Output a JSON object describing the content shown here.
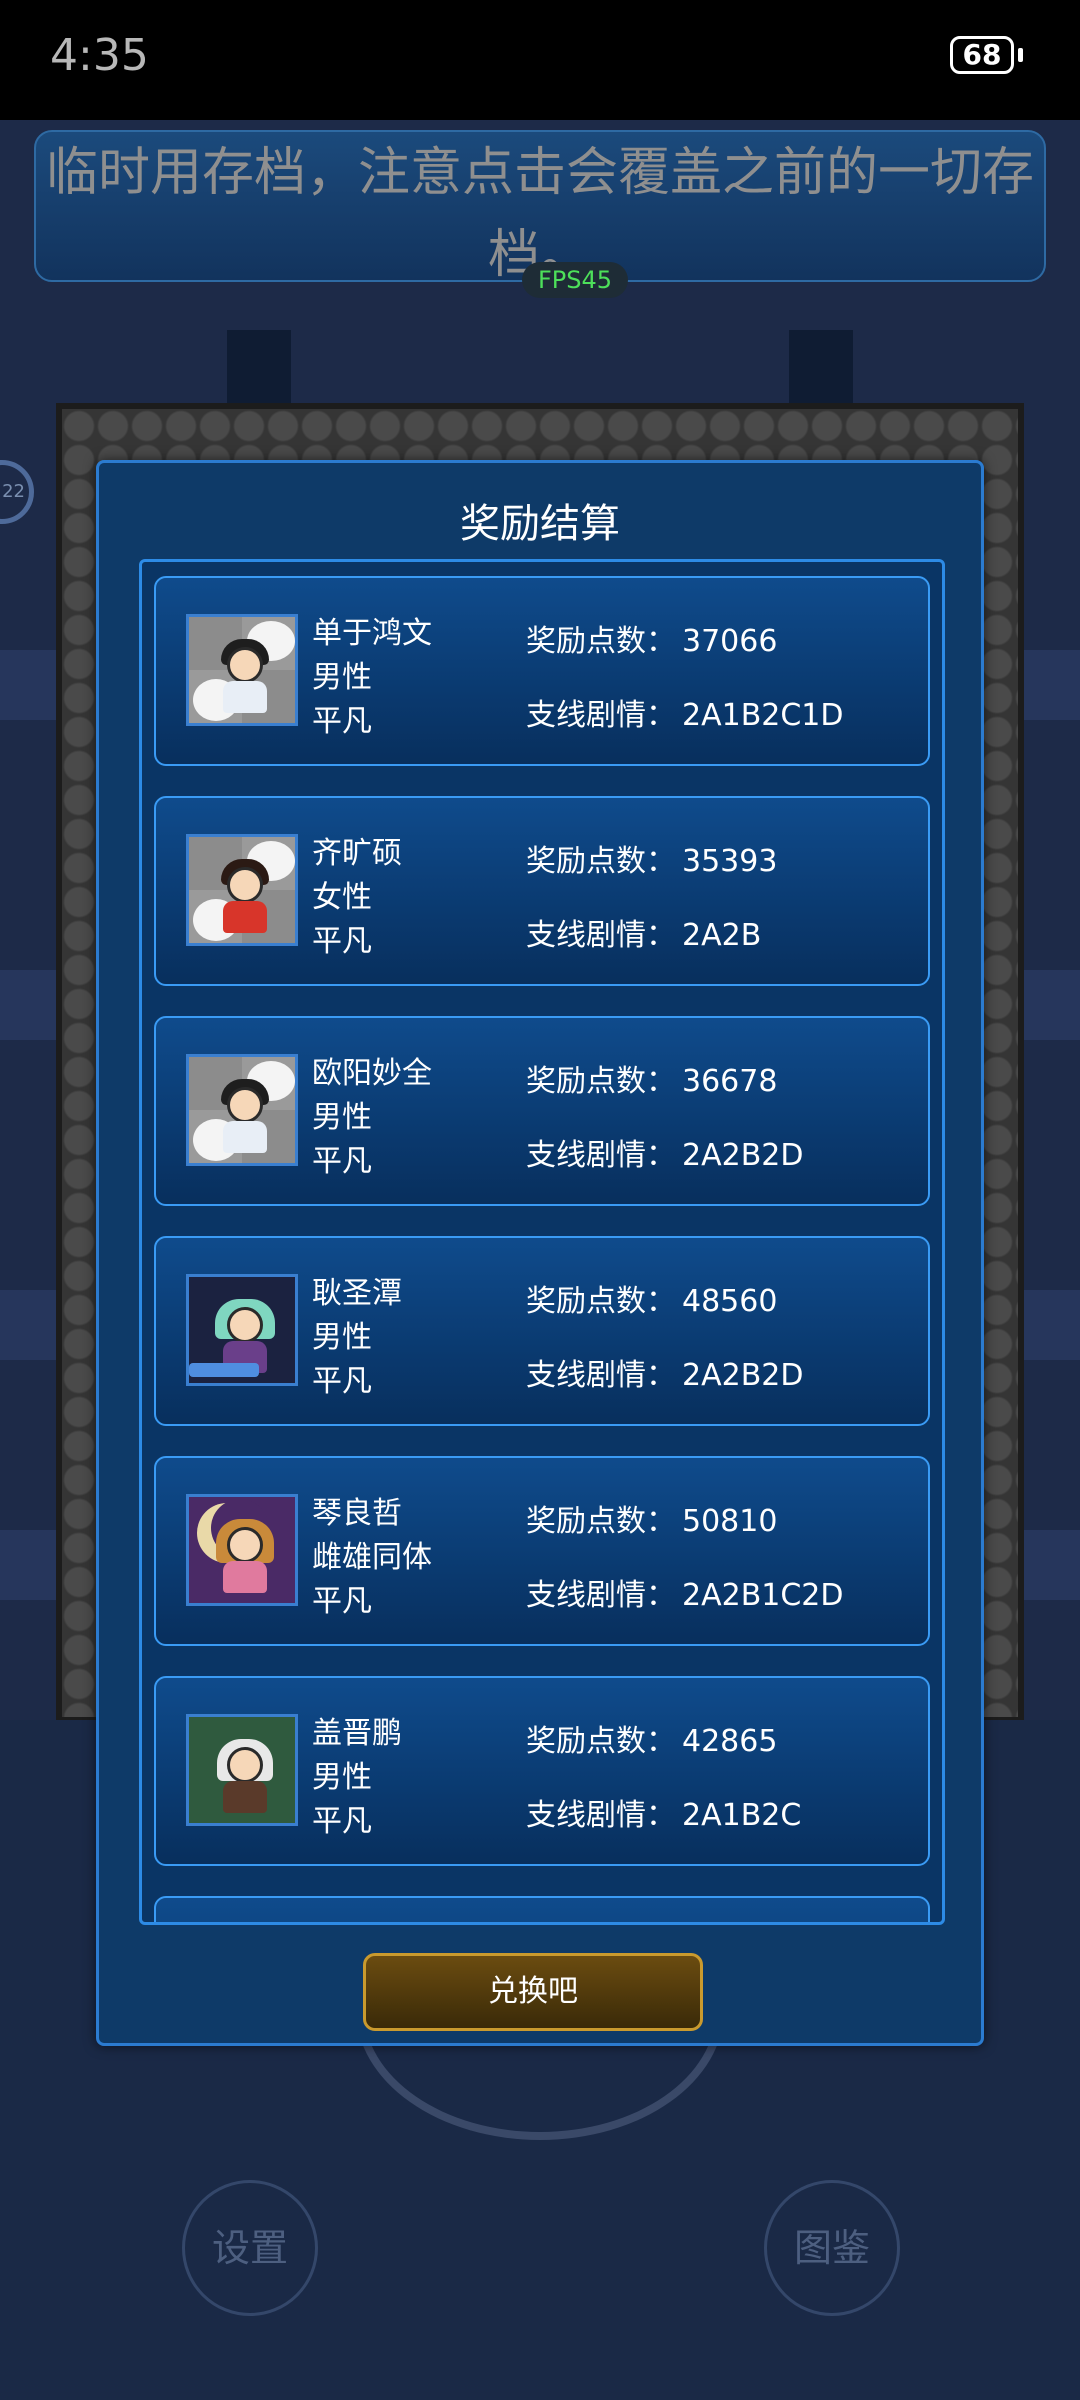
{
  "status_bar": {
    "time": "4:35",
    "battery": "68"
  },
  "background": {
    "banner_text": "临时用存档，注意点击会覆盖之前的一切存档。",
    "fps": "FPS45",
    "side_ring_value": "22",
    "settings_label": "设置",
    "codex_label": "图鉴"
  },
  "dialog": {
    "title": "奖励结算",
    "points_label": "奖励点数：",
    "branch_label": "支线剧情：",
    "exchange_label": "兑换吧",
    "entries": [
      {
        "name": "单于鸿文",
        "gender": "男性",
        "rank": "平凡",
        "points": "37066",
        "branch": "2A1B2C1D",
        "avatar": "white-robe-swordsman"
      },
      {
        "name": "齐旷硕",
        "gender": "女性",
        "rank": "平凡",
        "points": "35393",
        "branch": "2A2B",
        "avatar": "red-dress-girl"
      },
      {
        "name": "欧阳妙全",
        "gender": "男性",
        "rank": "平凡",
        "points": "36678",
        "branch": "2A2B2D",
        "avatar": "white-robe-swordsman"
      },
      {
        "name": "耿圣潭",
        "gender": "男性",
        "rank": "平凡",
        "points": "48560",
        "branch": "2A2B2D",
        "avatar": "green-hair-girl"
      },
      {
        "name": "琴良哲",
        "gender": "雌雄同体",
        "rank": "平凡",
        "points": "50810",
        "branch": "2A2B1C2D",
        "avatar": "moon-haired-girl"
      },
      {
        "name": "盖晋鹏",
        "gender": "男性",
        "rank": "平凡",
        "points": "42865",
        "branch": "2A1B2C",
        "avatar": "forest-warrior"
      }
    ]
  }
}
